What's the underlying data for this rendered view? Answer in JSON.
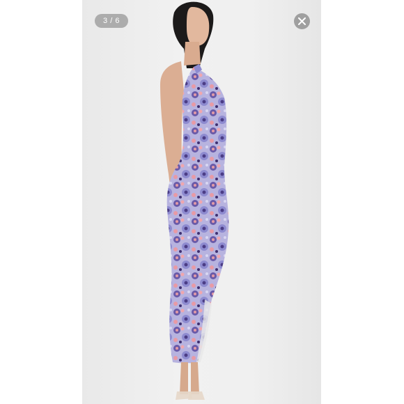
{
  "viewer": {
    "counter_label": "3 / 6"
  },
  "icons": {
    "close": "close-icon"
  },
  "colors": {
    "backdrop": "#f0f0f0",
    "overlay": "#787878"
  }
}
